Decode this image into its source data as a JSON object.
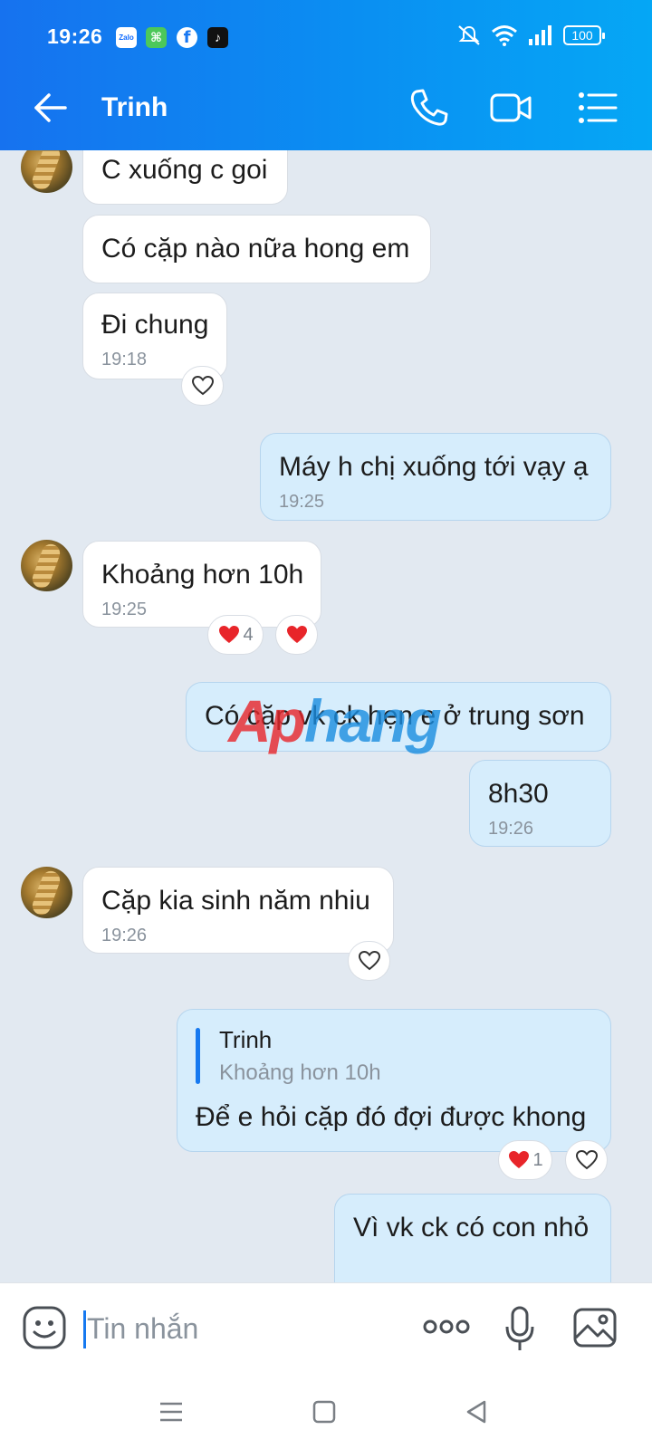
{
  "status_bar": {
    "time": "19:26",
    "apps": [
      "Zalo",
      "facebook",
      "tiktok"
    ],
    "battery": "100"
  },
  "header": {
    "title": "Trinh",
    "icons": [
      "back-arrow-icon",
      "phone-icon",
      "video-camera-icon",
      "menu-list-icon"
    ]
  },
  "messages": [
    {
      "side": "in",
      "text": "C xuống c goi"
    },
    {
      "side": "in",
      "text": "Có cặp nào nữa hong em"
    },
    {
      "side": "in",
      "text": "Đi chung",
      "time": "19:18",
      "reaction": "heart-outline"
    },
    {
      "side": "out",
      "text": "Máy h chị xuống tới vạy ạ",
      "time": "19:25"
    },
    {
      "side": "in",
      "text": "Khoảng hơn 10h",
      "time": "19:25",
      "reaction_count": "4",
      "reaction": "heart-filled"
    },
    {
      "side": "out",
      "text": "Có cặp vk ck hẹn e ở trung sơn"
    },
    {
      "side": "out",
      "text": "8h30",
      "time": "19:26"
    },
    {
      "side": "in",
      "text": "Cặp kia sinh năm nhiu",
      "time": "19:26",
      "reaction": "heart-outline"
    },
    {
      "side": "out",
      "reply_name": "Trinh",
      "reply_text": "Khoảng hơn 10h",
      "text": "Để e hỏi cặp đó đợi được khong",
      "reaction_count": "1"
    },
    {
      "side": "out",
      "text": "Vì vk ck có con nhỏ"
    }
  ],
  "watermark": {
    "part1": "Ap",
    "part2": "hang"
  },
  "input": {
    "placeholder": "Tin nhắn",
    "icons": [
      "emoji-icon",
      "more-dots-icon",
      "microphone-icon",
      "image-icon"
    ]
  },
  "navbar": {
    "icons": [
      "menu-icon",
      "home-icon",
      "back-icon"
    ]
  },
  "colors": {
    "header_start": "#1672ef",
    "header_end": "#05a7f5",
    "outgoing_bubble": "#d6edfc",
    "chat_bg": "#e2e9f1",
    "heart": "#e8252a"
  }
}
